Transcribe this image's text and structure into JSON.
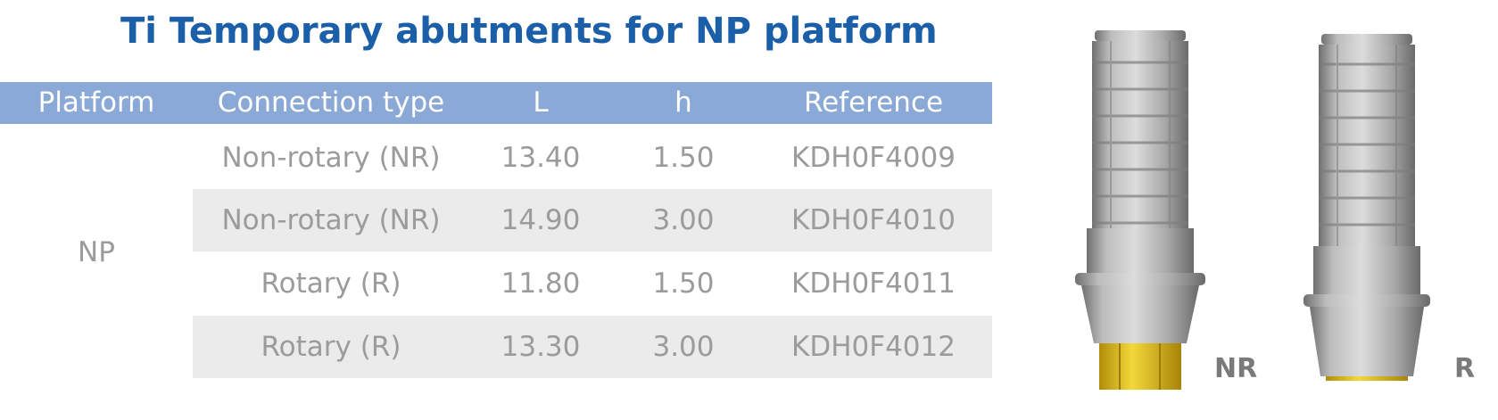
{
  "title": "Ti Temporary abutments for NP platform",
  "table": {
    "headers": [
      "Platform",
      "Connection type",
      "L",
      "h",
      "Reference"
    ],
    "platform": "NP",
    "rows": [
      {
        "connection": "Non-rotary (NR)",
        "L": "13.40",
        "h": "1.50",
        "reference": "KDH0F4009"
      },
      {
        "connection": "Non-rotary (NR)",
        "L": "14.90",
        "h": "3.00",
        "reference": "KDH0F4010"
      },
      {
        "connection": "Rotary (R)",
        "L": "11.80",
        "h": "1.50",
        "reference": "KDH0F4011"
      },
      {
        "connection": "Rotary (R)",
        "L": "13.30",
        "h": "3.00",
        "reference": "KDH0F4012"
      }
    ]
  },
  "images": {
    "nr_label": "NR",
    "r_label": "R"
  },
  "colors": {
    "title": "#1a5fa8",
    "header_bg": "#8aa9d6",
    "row_shade": "#ebebeb",
    "text_gray": "#9b9b9b",
    "gold_hex": "#e3c21f"
  }
}
